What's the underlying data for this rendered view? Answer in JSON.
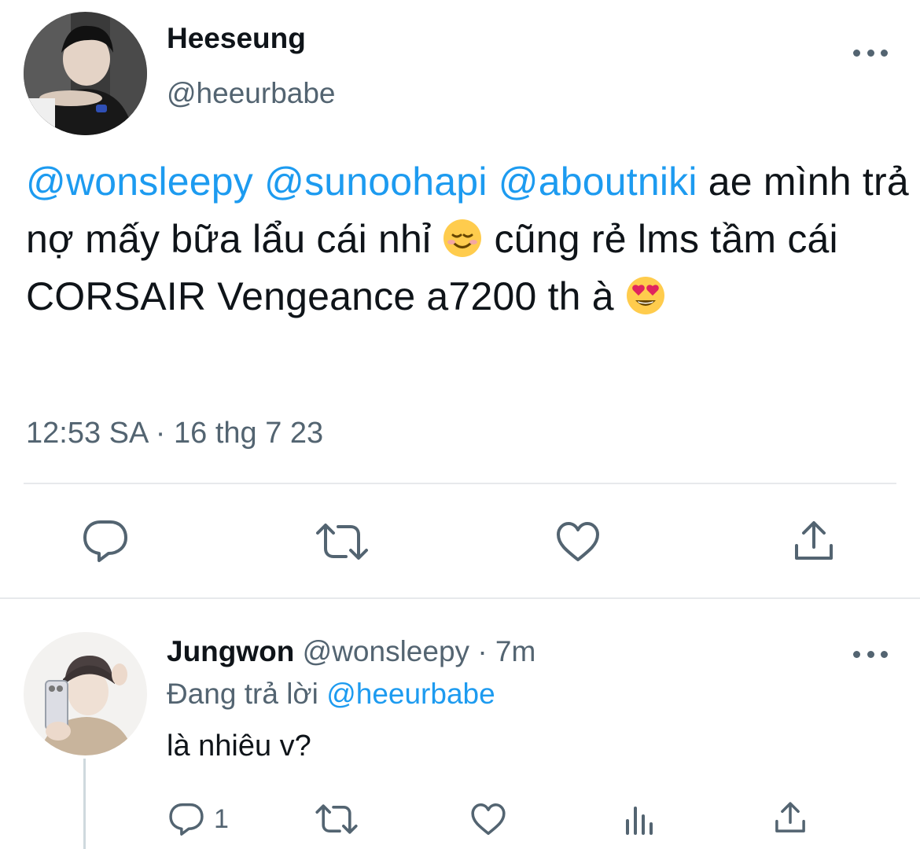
{
  "tweet": {
    "author_name": "Heeseung",
    "author_handle": "@heeurbabe",
    "mentions": [
      "@wonsleepy",
      "@sunoohapi",
      "@aboutniki"
    ],
    "text_part1": " ae mình trả nợ mấy bữa lẩu cái nhỉ ",
    "emoji1": "smiling-face-icon",
    "text_part2": "  cũng rẻ lms tầm cái CORSAIR Vengeance a7200 th à ",
    "emoji2": "heart-eyes-face-icon",
    "timestamp": "12:53 SA · 16 thg 7 23",
    "actions": [
      "reply-icon",
      "retweet-icon",
      "like-icon",
      "share-icon"
    ]
  },
  "reply": {
    "author_name": "Jungwon",
    "meta": " @wonsleepy · 7m",
    "replying_prefix": "Đang trả lời ",
    "replying_handle": "@heeurbabe",
    "text": "là nhiêu v?",
    "reply_count": "1",
    "actions": [
      "reply-icon",
      "retweet-icon",
      "like-icon",
      "analytics-icon",
      "share-icon"
    ]
  },
  "colors": {
    "link": "#1d9bf0",
    "secondary_text": "#536471",
    "divider": "#e7e9ec"
  }
}
